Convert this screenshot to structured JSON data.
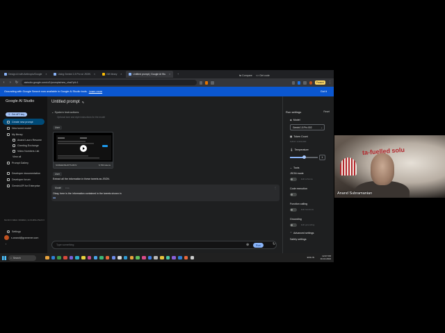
{
  "browser": {
    "tabs": [
      {
        "label": "Design AI with Anthropic/Google",
        "active": false
      },
      {
        "label": "Using Gemini 1.5 Pro w/ JSON",
        "active": false
      },
      {
        "label": "Gift library",
        "active": false
      },
      {
        "label": "Untitled prompt | Google AI Stu",
        "active": true
      }
    ],
    "url": "aistudio.google.com/u/1/prompts/new_chat?pli=1",
    "pause_label": "Paused"
  },
  "banner": {
    "text": "Grounding with Google Search now available in Google AI Studio tools.",
    "learn_more": "Learn more",
    "got_it": "Got it"
  },
  "sidebar": {
    "logo": "Google AI Studio",
    "api_key": "Get API key",
    "items": [
      {
        "label": "Create new prompt",
        "active": true
      },
      {
        "label": "New tuned model",
        "active": false
      },
      {
        "label": "My library",
        "active": false
      }
    ],
    "library": [
      "Anand Lauro Resume",
      "Greeting Exchange",
      "Video Numbers List",
      "View all"
    ],
    "prompt_gallery": "Prompt Gallery",
    "links": [
      "Developer documentation",
      "Developer forum",
      "Gemini API for Enterprise"
    ],
    "note": "Gemini makes mistakes, so double-check it",
    "settings": "Settings",
    "account": "s.anand@gramener.com"
  },
  "main": {
    "title": "Untitled prompt",
    "compare": "Compare",
    "get_code": "Get code",
    "system_instructions": "System Instructions",
    "system_placeholder": "Optional tone and style instructions for the model",
    "user_chip": "User",
    "video_caption": "SCREENSHOTS.MOV",
    "video_meta": "6,793 tokens",
    "user_chip2": "User",
    "user_prompt": "Extract all the information in these tweets as JSON.",
    "model_chip": "Model",
    "model_time": "0.1s",
    "model_reply": "Okay, here is the information contained in the tweets shown in",
    "input_placeholder": "Type something",
    "run_label": "Run"
  },
  "panel": {
    "title": "Run settings",
    "reset": "Reset",
    "model_label": "Model",
    "model_value": "Gemini 1.5 Pro 002",
    "token_label": "Token Count",
    "token_value": "6,833 / 2,000,000",
    "temperature_label": "Temperature",
    "temperature_value": "1",
    "temperature_fraction": 0.5,
    "tools_label": "Tools",
    "json_mode": "JSON mode",
    "json_edit": "Edit schema",
    "code_execution": "Code execution",
    "function_calling": "Function calling",
    "function_edit": "Edit functions",
    "grounding": "Grounding",
    "grounding_edit": "Edit grounding",
    "advanced": "Advanced settings",
    "safety": "Safety settings"
  },
  "taskbar": {
    "search": "Search",
    "icon_colors": [
      "#e8a33d",
      "#2f7fd6",
      "#3c9b48",
      "#d94a3c",
      "#7b61d9",
      "#2fb0c9",
      "#e8d23d",
      "#c94a8e",
      "#4aa3e8",
      "#3cb878",
      "#e86a3d",
      "#6e8be8",
      "#d9d9d9",
      "#2f9bd6",
      "#e8a33d",
      "#5fbf5f",
      "#d94a8a",
      "#3d7fe8",
      "#b8b8b8",
      "#e8c33d",
      "#4ac9a8",
      "#8a5fd9",
      "#2f7fd6",
      "#e8683d",
      "#cccccc"
    ],
    "time": "12:07 PM",
    "date": "10-10-2024",
    "lang": "ENG IN"
  },
  "webcam": {
    "name": "Anand Subramanian",
    "sign": "ta-fuelled solu"
  }
}
